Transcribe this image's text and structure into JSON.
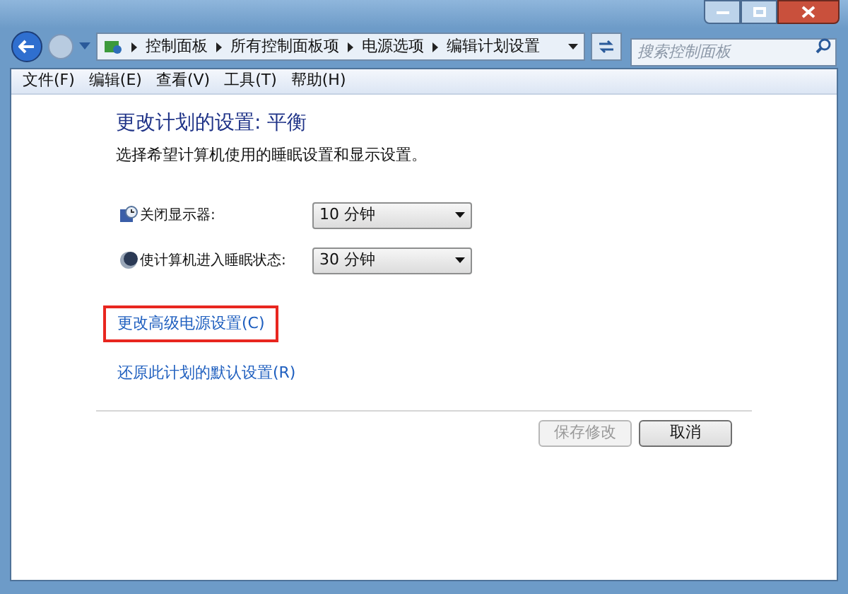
{
  "breadcrumb": [
    "控制面板",
    "所有控制面板项",
    "电源选项",
    "编辑计划设置"
  ],
  "search": {
    "placeholder": "搜索控制面板"
  },
  "menu": [
    "文件(F)",
    "编辑(E)",
    "查看(V)",
    "工具(T)",
    "帮助(H)"
  ],
  "heading": "更改计划的设置: 平衡",
  "subtitle": "选择希望计算机使用的睡眠设置和显示设置。",
  "settings": [
    {
      "kind": "display",
      "label": "关闭显示器:",
      "value": "10 分钟"
    },
    {
      "kind": "sleep",
      "label": "使计算机进入睡眠状态:",
      "value": "30 分钟"
    }
  ],
  "links": [
    {
      "text": "更改高级电源设置(C)",
      "highlighted": true
    },
    {
      "text": "还原此计划的默认设置(R)",
      "highlighted": false
    }
  ],
  "buttons": [
    {
      "label": "保存修改",
      "disabled": true
    },
    {
      "label": "取消",
      "disabled": false
    }
  ]
}
